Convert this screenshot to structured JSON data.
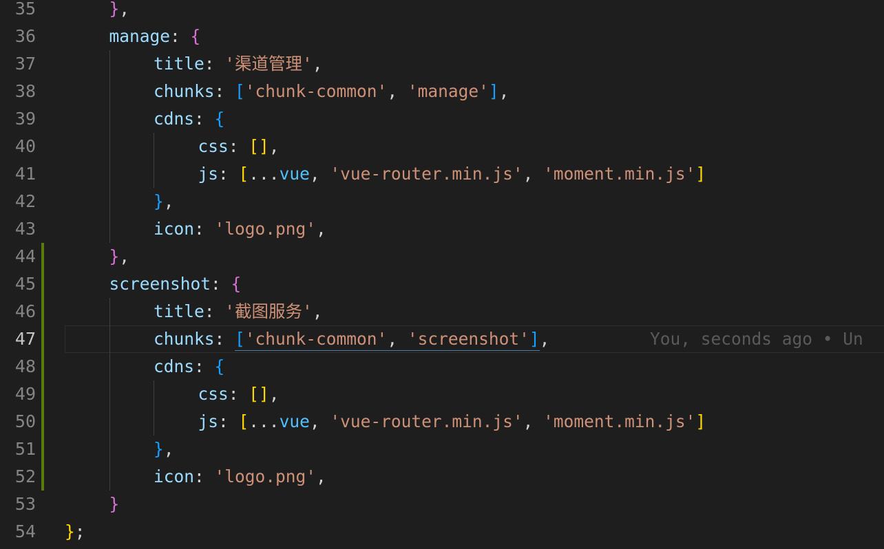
{
  "theme": {
    "background": "#1e1e1e",
    "gutter_fg": "#858585",
    "gutter_active_fg": "#c6c6c6",
    "git_added": "#587c0c",
    "colors": {
      "p": "#d4d4d4",
      "k": "#9cdcfe",
      "s": "#ce9178",
      "b1": "#ffd700",
      "b2": "#da70d6",
      "b3": "#179fff",
      "v": "#4fc1ff"
    }
  },
  "editor": {
    "current_line": 47,
    "blame_text": "You, seconds ago • Un",
    "lines": [
      {
        "num": "35",
        "indent": 1,
        "tokens": [
          [
            "b2",
            "}"
          ],
          [
            "p",
            ","
          ]
        ]
      },
      {
        "num": "36",
        "indent": 1,
        "tokens": [
          [
            "k",
            "manage"
          ],
          [
            "p",
            ": "
          ],
          [
            "b2",
            "{"
          ]
        ]
      },
      {
        "num": "37",
        "indent": 2,
        "tokens": [
          [
            "k",
            "title"
          ],
          [
            "p",
            ": "
          ],
          [
            "s",
            "'渠道管理'"
          ],
          [
            "p",
            ","
          ]
        ]
      },
      {
        "num": "38",
        "indent": 2,
        "tokens": [
          [
            "k",
            "chunks"
          ],
          [
            "p",
            ": "
          ],
          [
            "b3",
            "["
          ],
          [
            "s",
            "'chunk-common'"
          ],
          [
            "p",
            ", "
          ],
          [
            "s",
            "'manage'"
          ],
          [
            "b3",
            "]"
          ],
          [
            "p",
            ","
          ]
        ]
      },
      {
        "num": "39",
        "indent": 2,
        "tokens": [
          [
            "k",
            "cdns"
          ],
          [
            "p",
            ": "
          ],
          [
            "b3",
            "{"
          ]
        ]
      },
      {
        "num": "40",
        "indent": 3,
        "tokens": [
          [
            "k",
            "css"
          ],
          [
            "p",
            ": "
          ],
          [
            "b1",
            "[]"
          ],
          [
            "p",
            ","
          ]
        ]
      },
      {
        "num": "41",
        "indent": 3,
        "tokens": [
          [
            "k",
            "js"
          ],
          [
            "p",
            ": "
          ],
          [
            "b1",
            "["
          ],
          [
            "p",
            "..."
          ],
          [
            "v",
            "vue"
          ],
          [
            "p",
            ", "
          ],
          [
            "s",
            "'vue-router.min.js'"
          ],
          [
            "p",
            ", "
          ],
          [
            "s",
            "'moment.min.js'"
          ],
          [
            "b1",
            "]"
          ]
        ]
      },
      {
        "num": "42",
        "indent": 2,
        "tokens": [
          [
            "b3",
            "}"
          ],
          [
            "p",
            ","
          ]
        ]
      },
      {
        "num": "43",
        "indent": 2,
        "tokens": [
          [
            "k",
            "icon"
          ],
          [
            "p",
            ": "
          ],
          [
            "s",
            "'logo.png'"
          ],
          [
            "p",
            ","
          ]
        ]
      },
      {
        "num": "44",
        "indent": 1,
        "tokens": [
          [
            "b2",
            "}"
          ],
          [
            "p",
            ","
          ]
        ]
      },
      {
        "num": "45",
        "indent": 1,
        "tokens": [
          [
            "k",
            "screenshot"
          ],
          [
            "p",
            ": "
          ],
          [
            "b2",
            "{"
          ]
        ]
      },
      {
        "num": "46",
        "indent": 2,
        "tokens": [
          [
            "k",
            "title"
          ],
          [
            "p",
            ": "
          ],
          [
            "s",
            "'截图服务'"
          ],
          [
            "p",
            ","
          ]
        ]
      },
      {
        "num": "47",
        "indent": 2,
        "tokens": [
          [
            "k",
            "chunks"
          ],
          [
            "p",
            ": "
          ],
          [
            "b3",
            "["
          ],
          [
            "s",
            "'chunk-common'"
          ],
          [
            "p",
            ", "
          ],
          [
            "s",
            "'screenshot'"
          ],
          [
            "b3",
            "]"
          ],
          [
            "p",
            ","
          ]
        ]
      },
      {
        "num": "48",
        "indent": 2,
        "tokens": [
          [
            "k",
            "cdns"
          ],
          [
            "p",
            ": "
          ],
          [
            "b3",
            "{"
          ]
        ]
      },
      {
        "num": "49",
        "indent": 3,
        "tokens": [
          [
            "k",
            "css"
          ],
          [
            "p",
            ": "
          ],
          [
            "b1",
            "[]"
          ],
          [
            "p",
            ","
          ]
        ]
      },
      {
        "num": "50",
        "indent": 3,
        "tokens": [
          [
            "k",
            "js"
          ],
          [
            "p",
            ": "
          ],
          [
            "b1",
            "["
          ],
          [
            "p",
            "..."
          ],
          [
            "v",
            "vue"
          ],
          [
            "p",
            ", "
          ],
          [
            "s",
            "'vue-router.min.js'"
          ],
          [
            "p",
            ", "
          ],
          [
            "s",
            "'moment.min.js'"
          ],
          [
            "b1",
            "]"
          ]
        ]
      },
      {
        "num": "51",
        "indent": 2,
        "tokens": [
          [
            "b3",
            "}"
          ],
          [
            "p",
            ","
          ]
        ]
      },
      {
        "num": "52",
        "indent": 2,
        "tokens": [
          [
            "k",
            "icon"
          ],
          [
            "p",
            ": "
          ],
          [
            "s",
            "'logo.png'"
          ],
          [
            "p",
            ","
          ]
        ]
      },
      {
        "num": "53",
        "indent": 1,
        "tokens": [
          [
            "b2",
            "}"
          ]
        ]
      },
      {
        "num": "54",
        "indent": 0,
        "tokens": [
          [
            "b1",
            "}"
          ],
          [
            "p",
            ";"
          ]
        ]
      }
    ]
  }
}
